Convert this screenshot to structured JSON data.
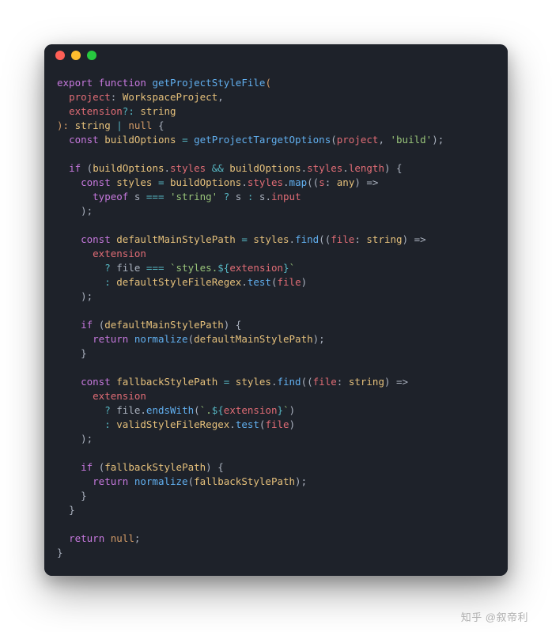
{
  "window": {
    "dots": [
      "close",
      "minimize",
      "zoom"
    ]
  },
  "code": {
    "line01_export": "export",
    "line01_function": "function",
    "line01_fname": "getProjectStyleFile",
    "line01_paren": "(",
    "line02_param": "project",
    "line02_colon": ": ",
    "line02_type": "WorkspaceProject",
    "line02_comma": ",",
    "line03_param": "extension",
    "line03_opt": "?: ",
    "line03_type": "string",
    "line04_close": "): ",
    "line04_t1": "string",
    "line04_pipe": " | ",
    "line04_null": "null",
    "line04_brace": " {",
    "line05_const": "const",
    "line05_var": "buildOptions",
    "line05_eq": " = ",
    "line05_fn": "getProjectTargetOptions",
    "line05_open": "(",
    "line05_a1": "project",
    "line05_c": ", ",
    "line05_str": "'build'",
    "line05_end": ");",
    "line07_if": "if",
    "line07_open": " (",
    "line07_bo": "buildOptions",
    "line07_dot": ".",
    "line07_styles": "styles",
    "line07_and": " && ",
    "line07_bo2": "buildOptions",
    "line07_dot2": ".",
    "line07_styles2": "styles",
    "line07_dot3": ".",
    "line07_len": "length",
    "line07_close": ") {",
    "line08_const": "const",
    "line08_var": "styles",
    "line08_eq": " = ",
    "line08_bo": "buildOptions",
    "line08_d1": ".",
    "line08_st": "styles",
    "line08_d2": ".",
    "line08_map": "map",
    "line08_open": "((",
    "line08_s": "s",
    "line08_colon": ": ",
    "line08_any": "any",
    "line08_arrow": ") =>",
    "line09_typeof": "typeof",
    "line09_s": " s ",
    "line09_eq3": "=== ",
    "line09_str": "'string'",
    "line09_q": " ? ",
    "line09_s2": "s",
    "line09_c": " : ",
    "line09_s3": "s",
    "line09_d": ".",
    "line09_inp": "input",
    "line10_close": ");",
    "line12_const": "const",
    "line12_var": "defaultMainStylePath",
    "line12_eq": " = ",
    "line12_styles": "styles",
    "line12_d": ".",
    "line12_find": "find",
    "line12_open": "((",
    "line12_file": "file",
    "line12_colon": ": ",
    "line12_str": "string",
    "line12_arrow": ") =>",
    "line13_ext": "extension",
    "line14_q": "? ",
    "line14_file": "file",
    "line14_eq3": " === ",
    "line14_tick1": "`styles.",
    "line14_dollar": "${",
    "line14_ext": "extension",
    "line14_close": "}",
    "line14_tick2": "`",
    "line15_c": ": ",
    "line15_regex": "defaultStyleFileRegex",
    "line15_d": ".",
    "line15_test": "test",
    "line15_open": "(",
    "line15_file": "file",
    "line15_close": ")",
    "line16_close": ");",
    "line18_if": "if",
    "line18_open": " (",
    "line18_var": "defaultMainStylePath",
    "line18_close": ") {",
    "line19_ret": "return",
    "line19_fn": "normalize",
    "line19_open": "(",
    "line19_arg": "defaultMainStylePath",
    "line19_close": ");",
    "line20_brace": "}",
    "line22_const": "const",
    "line22_var": "fallbackStylePath",
    "line22_eq": " = ",
    "line22_styles": "styles",
    "line22_d": ".",
    "line22_find": "find",
    "line22_open": "((",
    "line22_file": "file",
    "line22_colon": ": ",
    "line22_str": "string",
    "line22_arrow": ") =>",
    "line23_ext": "extension",
    "line24_q": "? ",
    "line24_file": "file",
    "line24_d": ".",
    "line24_ends": "endsWith",
    "line24_open": "(",
    "line24_tick1": "`.",
    "line24_dollar": "${",
    "line24_ext": "extension",
    "line24_close": "}",
    "line24_tick2": "`",
    "line24_cp": ")",
    "line25_c": ": ",
    "line25_regex": "validStyleFileRegex",
    "line25_d": ".",
    "line25_test": "test",
    "line25_open": "(",
    "line25_file": "file",
    "line25_close": ")",
    "line26_close": ");",
    "line28_if": "if",
    "line28_open": " (",
    "line28_var": "fallbackStylePath",
    "line28_close": ") {",
    "line29_ret": "return",
    "line29_fn": "normalize",
    "line29_open": "(",
    "line29_arg": "fallbackStylePath",
    "line29_close": ");",
    "line30_brace": "}",
    "line31_brace": "}",
    "line33_ret": "return",
    "line33_null": "null",
    "line33_semi": ";",
    "line34_brace": "}"
  },
  "watermark": "知乎 @叙帝利"
}
